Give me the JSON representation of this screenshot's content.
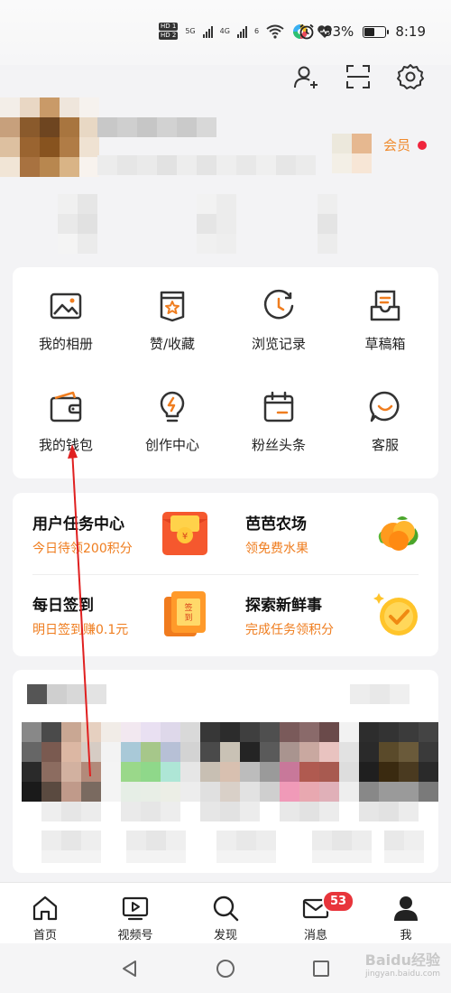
{
  "status_bar": {
    "battery": "53%",
    "time": "8:19",
    "network_labels": [
      "5G",
      "4G"
    ],
    "hd_labels": [
      "HD 1",
      "HD 2"
    ],
    "wifi_label": "6"
  },
  "top_actions": [
    {
      "icon": "add-friend-icon"
    },
    {
      "icon": "scan-icon"
    },
    {
      "icon": "settings-icon"
    }
  ],
  "profile": {
    "vip_label": "会员",
    "username": "",
    "stats": []
  },
  "quick_grid": [
    {
      "label": "我的相册",
      "icon": "photo-album-icon"
    },
    {
      "label": "赞/收藏",
      "icon": "favorites-icon"
    },
    {
      "label": "浏览记录",
      "icon": "history-icon"
    },
    {
      "label": "草稿箱",
      "icon": "drafts-icon"
    },
    {
      "label": "我的钱包",
      "icon": "wallet-icon"
    },
    {
      "label": "创作中心",
      "icon": "creator-center-icon"
    },
    {
      "label": "粉丝头条",
      "icon": "calendar-icon"
    },
    {
      "label": "客服",
      "icon": "customer-service-icon"
    }
  ],
  "tasks": [
    {
      "title": "用户任务中心",
      "subtitle": "今日待领200积分",
      "image": "red-envelope-icon"
    },
    {
      "title": "芭芭农场",
      "subtitle": "领免费水果",
      "image": "fruit-icon"
    },
    {
      "title": "每日签到",
      "subtitle": "明日签到赚0.1元",
      "image": "sign-in-card-icon"
    },
    {
      "title": "探索新鲜事",
      "subtitle": "完成任务领积分",
      "image": "check-coin-icon"
    }
  ],
  "bottom_nav": [
    {
      "label": "首页",
      "icon": "home-icon"
    },
    {
      "label": "视频号",
      "icon": "video-icon"
    },
    {
      "label": "发现",
      "icon": "discover-icon"
    },
    {
      "label": "消息",
      "icon": "message-icon",
      "badge": "53"
    },
    {
      "label": "我",
      "icon": "me-icon"
    }
  ],
  "watermark": {
    "text": "Baidu经验",
    "sub": "jingyan.baidu.com"
  },
  "colors": {
    "accent": "#ef7d1f",
    "badge": "#e8353b",
    "vip": "#f08a2c"
  }
}
